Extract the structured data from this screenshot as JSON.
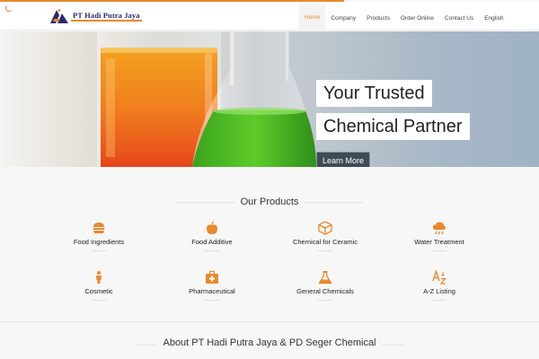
{
  "header": {
    "logo_text": "PT Hadi Putra Jaya",
    "nav": [
      {
        "label": "Home",
        "active": true
      },
      {
        "label": "Company"
      },
      {
        "label": "Products"
      },
      {
        "label": "Order Online"
      },
      {
        "label": "Contact Us"
      },
      {
        "label": "English"
      }
    ]
  },
  "hero": {
    "caption_line1": "Your Trusted",
    "caption_line2": "Chemical Partner",
    "button_label": "Learn More"
  },
  "products": {
    "title": "Our Products",
    "items": [
      {
        "label": "Food Ingredients",
        "icon": "burger-icon"
      },
      {
        "label": "Food Additive",
        "icon": "apple-icon"
      },
      {
        "label": "Chemical for Ceramic",
        "icon": "cube-icon"
      },
      {
        "label": "Water Treatment",
        "icon": "rain-cloud-icon"
      },
      {
        "label": "Cosmetic",
        "icon": "person-icon"
      },
      {
        "label": "Pharmaceutical",
        "icon": "medkit-icon"
      },
      {
        "label": "General Chemicals",
        "icon": "flask-icon"
      },
      {
        "label": "A-Z Listing",
        "icon": "az-sort-icon"
      }
    ]
  },
  "about": {
    "title": "About PT Hadi Putra Jaya & PD Seger Chemical"
  },
  "colors": {
    "accent": "#e8892b",
    "brand_navy": "#2a2a6e",
    "button_bg": "#3f4a55"
  }
}
